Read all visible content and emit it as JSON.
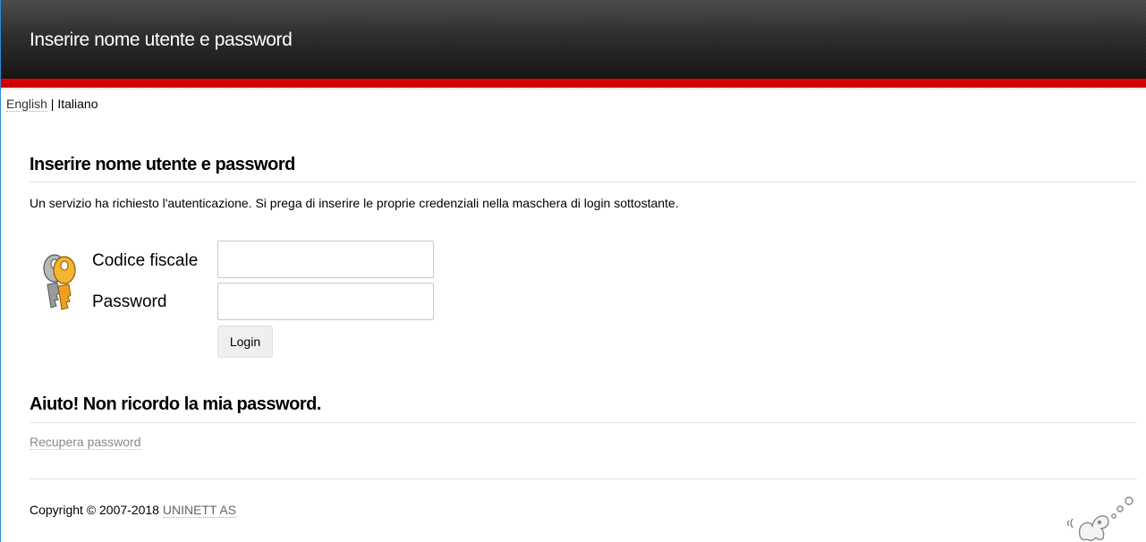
{
  "header": {
    "title": "Inserire nome utente e password"
  },
  "language": {
    "english": "English",
    "separator": " | ",
    "italiano": "Italiano"
  },
  "main": {
    "heading": "Inserire nome utente e password",
    "intro": "Un servizio ha richiesto l'autenticazione. Si prega di inserire le proprie credenziali nella maschera di login sottostante.",
    "form": {
      "username_label": "Codice fiscale",
      "username_value": "",
      "password_label": "Password",
      "password_value": "",
      "login_label": "Login"
    },
    "help_heading": "Aiuto! Non ricordo la mia password.",
    "recover_link": "Recupera password"
  },
  "footer": {
    "copyright_text": "Copyright © 2007-2018 ",
    "company_link": "UNINETT AS"
  },
  "colors": {
    "header_dark": "#2a2a2a",
    "accent_red": "#d60000",
    "link_gray": "#8a8a8a"
  }
}
